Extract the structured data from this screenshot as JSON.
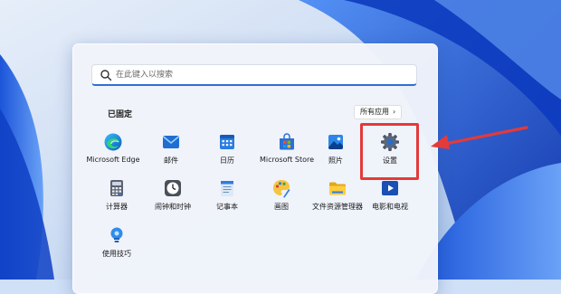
{
  "search": {
    "placeholder": "在此键入以搜索"
  },
  "pinned": {
    "title": "已固定",
    "all_apps_label": "所有应用",
    "items": [
      {
        "label": "Microsoft Edge",
        "icon": "edge-icon"
      },
      {
        "label": "邮件",
        "icon": "mail-icon"
      },
      {
        "label": "日历",
        "icon": "calendar-icon"
      },
      {
        "label": "Microsoft Store",
        "icon": "store-icon"
      },
      {
        "label": "照片",
        "icon": "photos-icon"
      },
      {
        "label": "设置",
        "icon": "gear-icon"
      },
      {
        "label": "计算器",
        "icon": "calculator-icon"
      },
      {
        "label": "闹钟和时钟",
        "icon": "clock-icon"
      },
      {
        "label": "记事本",
        "icon": "notepad-icon"
      },
      {
        "label": "画图",
        "icon": "paint-icon"
      },
      {
        "label": "文件资源管理器",
        "icon": "folder-icon"
      },
      {
        "label": "电影和电视",
        "icon": "movies-icon"
      },
      {
        "label": "使用技巧",
        "icon": "tips-icon"
      }
    ]
  },
  "colors": {
    "accent": "#2f6fd6",
    "highlight": "#e33a3a",
    "wallpaper": "#1b56d8"
  }
}
